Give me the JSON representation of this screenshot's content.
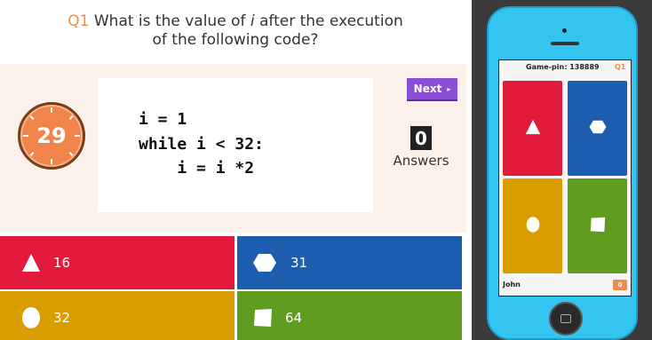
{
  "question": {
    "number": "Q1",
    "text_part1": " What is the value of ",
    "variable": "i",
    "text_part2": " after the execution",
    "text_line2": "of the following code?"
  },
  "timer": {
    "value": "29",
    "icon": "clock-icon"
  },
  "code": {
    "line1": "i = 1",
    "line2": "while i < 32:",
    "line3": "    i = i *2"
  },
  "next_button": {
    "label": "Next",
    "icon": "chevron-right-icon"
  },
  "answers_count": {
    "value": "0",
    "label": "Answers"
  },
  "answers": [
    {
      "label": "16",
      "shape": "triangle-icon",
      "color": "#e21b3c"
    },
    {
      "label": "31",
      "shape": "hexagon-icon",
      "color": "#1c5db0"
    },
    {
      "label": "32",
      "shape": "circle-icon",
      "color": "#d89e00"
    },
    {
      "label": "64",
      "shape": "square-icon",
      "color": "#5f9c1f"
    }
  ],
  "phone": {
    "game_pin_label": "Game-pin: 138889",
    "question_number": "Q1",
    "user_name": "John",
    "score": "0",
    "tiles": [
      {
        "shape": "triangle-icon",
        "color": "#e21b3c"
      },
      {
        "shape": "hexagon-icon",
        "color": "#1c5db0"
      },
      {
        "shape": "circle-icon",
        "color": "#d89e00"
      },
      {
        "shape": "square-icon",
        "color": "#5f9c1f"
      }
    ]
  },
  "colors": {
    "accent": "#f08a4b",
    "next_button": "#8a4fd6",
    "stage_background": "#fbf0ea",
    "phone_body": "#33c4ef"
  }
}
